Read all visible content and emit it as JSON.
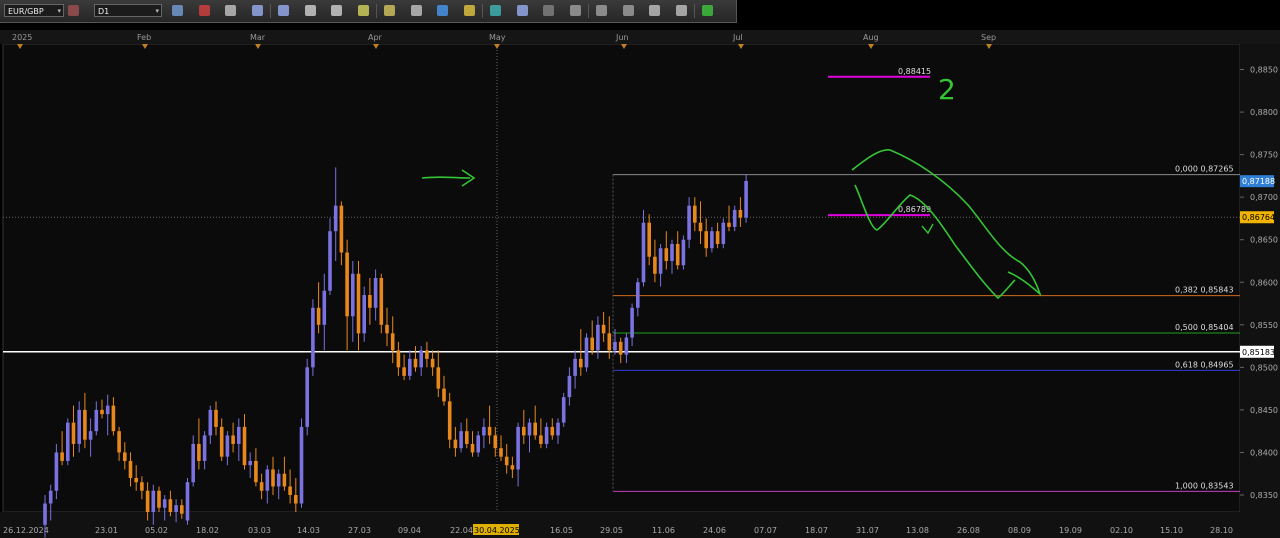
{
  "toolbar": {
    "symbol": "EUR/GBP",
    "timeframe": "D1",
    "icons": [
      "chart-type-icon",
      "bar-chart-icon",
      "candle-chart-icon",
      "zoom-in-icon",
      "zoom-out-icon",
      "cursor-icon",
      "crosshair-icon",
      "text-icon",
      "comment-icon",
      "camera-icon",
      "globe-icon",
      "pencil-icon",
      "objects-icon",
      "template-icon",
      "fib-icon",
      "channel-icon",
      "lines-icon",
      "trend-icon",
      "ellipse-icon",
      "eraser-icon",
      "indicators-icon"
    ]
  },
  "chart_data": {
    "type": "candlestick",
    "symbol": "EUR/GBP",
    "timeframe": "D1",
    "top_months": [
      "2025",
      "Feb",
      "Mar",
      "Apr",
      "May",
      "Jun",
      "Jul",
      "Aug",
      "Sep"
    ],
    "x_tick_labels": [
      "26.12.2024",
      "23.01",
      "05.02",
      "18.02",
      "03.03",
      "14.03",
      "27.03",
      "09.04",
      "22.04",
      "30.04.2025",
      "16.05",
      "29.05",
      "11.06",
      "24.06",
      "07.07",
      "18.07",
      "31.07",
      "13.08",
      "26.08",
      "08.09",
      "19.09",
      "02.10",
      "15.10",
      "28.10"
    ],
    "ylim": [
      0.833,
      0.888
    ],
    "y_ticks": [
      "0,8850",
      "0,8800",
      "0,8750",
      "0,8700",
      "0,8650",
      "0,8600",
      "0,8550",
      "0,8500",
      "0,8450",
      "0,8400",
      "0,8350"
    ],
    "price_tags": [
      {
        "label": "0,87188",
        "value": 0.87188,
        "color": "#2f7fd6"
      },
      {
        "label": "0,86764",
        "value": 0.86764,
        "color": "#f2b400"
      },
      {
        "label": "0,85183",
        "value": 0.85183,
        "color": "#ffffff"
      }
    ],
    "horizontal_line": {
      "value": 0.85183,
      "color": "#ffffff"
    },
    "fibonacci": [
      {
        "label": "0,000 0,87265",
        "value": 0.87265,
        "color": "#8a8a8a"
      },
      {
        "label": "0,382 0,85843",
        "value": 0.85843,
        "color": "#d06a1a"
      },
      {
        "label": "0,500 0,85404",
        "value": 0.85404,
        "color": "#1fa01f"
      },
      {
        "label": "0,618 0,84965",
        "value": 0.84965,
        "color": "#2f3fd0"
      },
      {
        "label": "1,000 0,83543",
        "value": 0.83543,
        "color": "#c040c0"
      }
    ],
    "level_lines": [
      {
        "label": "0,88415",
        "value": 0.88415,
        "color": "#e000e0"
      },
      {
        "label": "0,86789",
        "value": 0.86789,
        "color": "#e000e0"
      }
    ],
    "annotations": [
      "2"
    ],
    "candles": [
      {
        "o": 0.8315,
        "h": 0.835,
        "l": 0.83,
        "c": 0.834
      },
      {
        "o": 0.834,
        "h": 0.8362,
        "l": 0.832,
        "c": 0.8355
      },
      {
        "o": 0.8355,
        "h": 0.841,
        "l": 0.8345,
        "c": 0.84
      },
      {
        "o": 0.84,
        "h": 0.8425,
        "l": 0.8385,
        "c": 0.839
      },
      {
        "o": 0.839,
        "h": 0.844,
        "l": 0.8385,
        "c": 0.8435
      },
      {
        "o": 0.8435,
        "h": 0.8455,
        "l": 0.8395,
        "c": 0.841
      },
      {
        "o": 0.841,
        "h": 0.846,
        "l": 0.84,
        "c": 0.845
      },
      {
        "o": 0.845,
        "h": 0.847,
        "l": 0.8405,
        "c": 0.8415
      },
      {
        "o": 0.8415,
        "h": 0.844,
        "l": 0.8395,
        "c": 0.8425
      },
      {
        "o": 0.8425,
        "h": 0.846,
        "l": 0.842,
        "c": 0.845
      },
      {
        "o": 0.845,
        "h": 0.8462,
        "l": 0.844,
        "c": 0.8445
      },
      {
        "o": 0.8445,
        "h": 0.8468,
        "l": 0.842,
        "c": 0.8455
      },
      {
        "o": 0.8455,
        "h": 0.8465,
        "l": 0.842,
        "c": 0.8425
      },
      {
        "o": 0.8425,
        "h": 0.843,
        "l": 0.839,
        "c": 0.84
      },
      {
        "o": 0.84,
        "h": 0.8412,
        "l": 0.838,
        "c": 0.839
      },
      {
        "o": 0.839,
        "h": 0.84,
        "l": 0.836,
        "c": 0.837
      },
      {
        "o": 0.837,
        "h": 0.8385,
        "l": 0.8355,
        "c": 0.8365
      },
      {
        "o": 0.8365,
        "h": 0.8372,
        "l": 0.8345,
        "c": 0.8355
      },
      {
        "o": 0.8355,
        "h": 0.8365,
        "l": 0.832,
        "c": 0.833
      },
      {
        "o": 0.833,
        "h": 0.8362,
        "l": 0.8315,
        "c": 0.8355
      },
      {
        "o": 0.8355,
        "h": 0.836,
        "l": 0.833,
        "c": 0.8335
      },
      {
        "o": 0.8335,
        "h": 0.835,
        "l": 0.832,
        "c": 0.8345
      },
      {
        "o": 0.8345,
        "h": 0.8355,
        "l": 0.8325,
        "c": 0.833
      },
      {
        "o": 0.833,
        "h": 0.8345,
        "l": 0.8318,
        "c": 0.8338
      },
      {
        "o": 0.8338,
        "h": 0.8345,
        "l": 0.8322,
        "c": 0.8328
      },
      {
        "o": 0.832,
        "h": 0.837,
        "l": 0.8315,
        "c": 0.8365
      },
      {
        "o": 0.8365,
        "h": 0.842,
        "l": 0.836,
        "c": 0.841
      },
      {
        "o": 0.841,
        "h": 0.844,
        "l": 0.838,
        "c": 0.839
      },
      {
        "o": 0.839,
        "h": 0.8425,
        "l": 0.838,
        "c": 0.842
      },
      {
        "o": 0.842,
        "h": 0.8455,
        "l": 0.841,
        "c": 0.845
      },
      {
        "o": 0.845,
        "h": 0.846,
        "l": 0.842,
        "c": 0.843
      },
      {
        "o": 0.843,
        "h": 0.844,
        "l": 0.839,
        "c": 0.8395
      },
      {
        "o": 0.8395,
        "h": 0.8425,
        "l": 0.8385,
        "c": 0.842
      },
      {
        "o": 0.842,
        "h": 0.8435,
        "l": 0.84,
        "c": 0.841
      },
      {
        "o": 0.841,
        "h": 0.844,
        "l": 0.839,
        "c": 0.843
      },
      {
        "o": 0.843,
        "h": 0.8445,
        "l": 0.838,
        "c": 0.8385
      },
      {
        "o": 0.8385,
        "h": 0.84,
        "l": 0.837,
        "c": 0.839
      },
      {
        "o": 0.839,
        "h": 0.8405,
        "l": 0.836,
        "c": 0.8365
      },
      {
        "o": 0.8365,
        "h": 0.8375,
        "l": 0.8345,
        "c": 0.8355
      },
      {
        "o": 0.8355,
        "h": 0.8385,
        "l": 0.834,
        "c": 0.838
      },
      {
        "o": 0.838,
        "h": 0.8395,
        "l": 0.835,
        "c": 0.836
      },
      {
        "o": 0.836,
        "h": 0.838,
        "l": 0.8345,
        "c": 0.8375
      },
      {
        "o": 0.8375,
        "h": 0.8395,
        "l": 0.8355,
        "c": 0.836
      },
      {
        "o": 0.836,
        "h": 0.838,
        "l": 0.834,
        "c": 0.835
      },
      {
        "o": 0.835,
        "h": 0.837,
        "l": 0.833,
        "c": 0.834
      },
      {
        "o": 0.834,
        "h": 0.844,
        "l": 0.8335,
        "c": 0.843
      },
      {
        "o": 0.843,
        "h": 0.851,
        "l": 0.842,
        "c": 0.85
      },
      {
        "o": 0.85,
        "h": 0.858,
        "l": 0.849,
        "c": 0.857
      },
      {
        "o": 0.857,
        "h": 0.86,
        "l": 0.854,
        "c": 0.855
      },
      {
        "o": 0.855,
        "h": 0.861,
        "l": 0.852,
        "c": 0.859
      },
      {
        "o": 0.859,
        "h": 0.8675,
        "l": 0.8585,
        "c": 0.866
      },
      {
        "o": 0.866,
        "h": 0.8735,
        "l": 0.8625,
        "c": 0.869
      },
      {
        "o": 0.869,
        "h": 0.8695,
        "l": 0.862,
        "c": 0.8635
      },
      {
        "o": 0.8635,
        "h": 0.865,
        "l": 0.852,
        "c": 0.856
      },
      {
        "o": 0.856,
        "h": 0.8625,
        "l": 0.853,
        "c": 0.861
      },
      {
        "o": 0.861,
        "h": 0.8625,
        "l": 0.852,
        "c": 0.854
      },
      {
        "o": 0.854,
        "h": 0.8595,
        "l": 0.853,
        "c": 0.8585
      },
      {
        "o": 0.8585,
        "h": 0.8605,
        "l": 0.855,
        "c": 0.857
      },
      {
        "o": 0.857,
        "h": 0.8615,
        "l": 0.8555,
        "c": 0.8605
      },
      {
        "o": 0.8605,
        "h": 0.861,
        "l": 0.854,
        "c": 0.855
      },
      {
        "o": 0.855,
        "h": 0.857,
        "l": 0.8525,
        "c": 0.854
      },
      {
        "o": 0.854,
        "h": 0.856,
        "l": 0.8505,
        "c": 0.852
      },
      {
        "o": 0.852,
        "h": 0.853,
        "l": 0.849,
        "c": 0.85
      },
      {
        "o": 0.85,
        "h": 0.8515,
        "l": 0.8485,
        "c": 0.849
      },
      {
        "o": 0.849,
        "h": 0.852,
        "l": 0.8485,
        "c": 0.851
      },
      {
        "o": 0.851,
        "h": 0.8525,
        "l": 0.8495,
        "c": 0.85
      },
      {
        "o": 0.85,
        "h": 0.8525,
        "l": 0.849,
        "c": 0.852
      },
      {
        "o": 0.852,
        "h": 0.853,
        "l": 0.85,
        "c": 0.851
      },
      {
        "o": 0.851,
        "h": 0.852,
        "l": 0.849,
        "c": 0.85
      },
      {
        "o": 0.85,
        "h": 0.852,
        "l": 0.8465,
        "c": 0.8475
      },
      {
        "o": 0.8475,
        "h": 0.849,
        "l": 0.8455,
        "c": 0.846
      },
      {
        "o": 0.846,
        "h": 0.847,
        "l": 0.8405,
        "c": 0.8415
      },
      {
        "o": 0.8415,
        "h": 0.843,
        "l": 0.8395,
        "c": 0.8405
      },
      {
        "o": 0.8405,
        "h": 0.8435,
        "l": 0.84,
        "c": 0.8425
      },
      {
        "o": 0.8425,
        "h": 0.844,
        "l": 0.8405,
        "c": 0.841
      },
      {
        "o": 0.841,
        "h": 0.8425,
        "l": 0.8395,
        "c": 0.84
      },
      {
        "o": 0.84,
        "h": 0.8425,
        "l": 0.8395,
        "c": 0.842
      },
      {
        "o": 0.842,
        "h": 0.844,
        "l": 0.8405,
        "c": 0.843
      },
      {
        "o": 0.843,
        "h": 0.8455,
        "l": 0.841,
        "c": 0.842
      },
      {
        "o": 0.842,
        "h": 0.843,
        "l": 0.8395,
        "c": 0.8405
      },
      {
        "o": 0.8405,
        "h": 0.842,
        "l": 0.839,
        "c": 0.8395
      },
      {
        "o": 0.8395,
        "h": 0.841,
        "l": 0.8375,
        "c": 0.8385
      },
      {
        "o": 0.8385,
        "h": 0.8395,
        "l": 0.837,
        "c": 0.838
      },
      {
        "o": 0.838,
        "h": 0.8435,
        "l": 0.836,
        "c": 0.843
      },
      {
        "o": 0.843,
        "h": 0.845,
        "l": 0.841,
        "c": 0.842
      },
      {
        "o": 0.842,
        "h": 0.844,
        "l": 0.84,
        "c": 0.8435
      },
      {
        "o": 0.8435,
        "h": 0.8455,
        "l": 0.8415,
        "c": 0.842
      },
      {
        "o": 0.842,
        "h": 0.844,
        "l": 0.8405,
        "c": 0.841
      },
      {
        "o": 0.841,
        "h": 0.8435,
        "l": 0.8405,
        "c": 0.843
      },
      {
        "o": 0.843,
        "h": 0.844,
        "l": 0.8415,
        "c": 0.842
      },
      {
        "o": 0.842,
        "h": 0.844,
        "l": 0.841,
        "c": 0.8435
      },
      {
        "o": 0.8435,
        "h": 0.847,
        "l": 0.843,
        "c": 0.8465
      },
      {
        "o": 0.8465,
        "h": 0.85,
        "l": 0.8455,
        "c": 0.849
      },
      {
        "o": 0.849,
        "h": 0.852,
        "l": 0.8475,
        "c": 0.851
      },
      {
        "o": 0.851,
        "h": 0.8545,
        "l": 0.849,
        "c": 0.85
      },
      {
        "o": 0.85,
        "h": 0.854,
        "l": 0.8495,
        "c": 0.8535
      },
      {
        "o": 0.8535,
        "h": 0.8555,
        "l": 0.8515,
        "c": 0.852
      },
      {
        "o": 0.852,
        "h": 0.856,
        "l": 0.851,
        "c": 0.855
      },
      {
        "o": 0.855,
        "h": 0.8565,
        "l": 0.853,
        "c": 0.854
      },
      {
        "o": 0.854,
        "h": 0.856,
        "l": 0.851,
        "c": 0.852
      },
      {
        "o": 0.852,
        "h": 0.8545,
        "l": 0.8515,
        "c": 0.853
      },
      {
        "o": 0.853,
        "h": 0.8535,
        "l": 0.8505,
        "c": 0.8515
      },
      {
        "o": 0.8515,
        "h": 0.854,
        "l": 0.8505,
        "c": 0.8535
      },
      {
        "o": 0.8535,
        "h": 0.8575,
        "l": 0.8525,
        "c": 0.857
      },
      {
        "o": 0.857,
        "h": 0.8605,
        "l": 0.856,
        "c": 0.86
      },
      {
        "o": 0.86,
        "h": 0.8685,
        "l": 0.8595,
        "c": 0.867
      },
      {
        "o": 0.867,
        "h": 0.868,
        "l": 0.862,
        "c": 0.863
      },
      {
        "o": 0.863,
        "h": 0.865,
        "l": 0.86,
        "c": 0.861
      },
      {
        "o": 0.861,
        "h": 0.8645,
        "l": 0.8595,
        "c": 0.864
      },
      {
        "o": 0.864,
        "h": 0.866,
        "l": 0.8615,
        "c": 0.8625
      },
      {
        "o": 0.8625,
        "h": 0.865,
        "l": 0.861,
        "c": 0.8645
      },
      {
        "o": 0.8645,
        "h": 0.866,
        "l": 0.8615,
        "c": 0.862
      },
      {
        "o": 0.862,
        "h": 0.8655,
        "l": 0.8615,
        "c": 0.865
      },
      {
        "o": 0.865,
        "h": 0.87,
        "l": 0.864,
        "c": 0.869
      },
      {
        "o": 0.869,
        "h": 0.87,
        "l": 0.866,
        "c": 0.867
      },
      {
        "o": 0.867,
        "h": 0.8695,
        "l": 0.8645,
        "c": 0.866
      },
      {
        "o": 0.866,
        "h": 0.8675,
        "l": 0.863,
        "c": 0.864
      },
      {
        "o": 0.864,
        "h": 0.8665,
        "l": 0.8635,
        "c": 0.866
      },
      {
        "o": 0.866,
        "h": 0.867,
        "l": 0.864,
        "c": 0.8645
      },
      {
        "o": 0.8645,
        "h": 0.8675,
        "l": 0.864,
        "c": 0.867
      },
      {
        "o": 0.867,
        "h": 0.869,
        "l": 0.866,
        "c": 0.8665
      },
      {
        "o": 0.8665,
        "h": 0.869,
        "l": 0.866,
        "c": 0.8685
      },
      {
        "o": 0.8685,
        "h": 0.87,
        "l": 0.8665,
        "c": 0.8676
      },
      {
        "o": 0.8676,
        "h": 0.8727,
        "l": 0.867,
        "c": 0.8719
      }
    ]
  }
}
